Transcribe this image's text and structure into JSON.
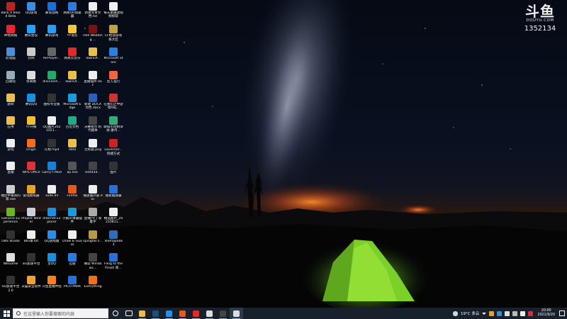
{
  "watermark": {
    "logo": "斗鱼",
    "url": "DOUYU.COM",
    "room_id": "1352134"
  },
  "desktop": {
    "icons": [
      {
        "label": "Back 4 Blood Beta",
        "color": "#b22"
      },
      {
        "label": "QQ游戏",
        "color": "#3a8de0"
      },
      {
        "label": "暴雪战网",
        "color": "#1a6fd8"
      },
      {
        "label": "网易UU加速器",
        "color": "#2d7be0"
      },
      {
        "label": "新建文本文档.txt",
        "color": "#eee"
      },
      {
        "label": "每天素播放视频抓取",
        "color": "#f0f0f0"
      },
      {
        "label": "神经网络",
        "color": "#e23"
      },
      {
        "label": "腾讯会议",
        "color": "#23a0ff"
      },
      {
        "label": "腾讯游戏",
        "color": "#2a9df4"
      },
      {
        "label": "YY语音",
        "color": "#f6c33a"
      },
      {
        "label": "Hell Wedding ...",
        "color": "#7a1010"
      },
      {
        "label": "CF枪战游戏排大区",
        "color": "#c0a040"
      },
      {
        "label": "此电脑",
        "color": "#4a8fd8"
      },
      {
        "label": "封闭",
        "color": "#ccc"
      },
      {
        "label": "AirPlayer...",
        "color": "#666"
      },
      {
        "label": "网易云音乐",
        "color": "#e02b2b"
      },
      {
        "label": "TownOf...",
        "color": "#e8c050"
      },
      {
        "label": "Microsoft Store",
        "color": "#2b80d9"
      },
      {
        "label": "回收站",
        "color": "#9ab"
      },
      {
        "label": "仿真模",
        "color": "#ddd"
      },
      {
        "label": "dilcaTech...",
        "color": "#2a6"
      },
      {
        "label": "TownOf...",
        "color": "#e8c050"
      },
      {
        "label": "直播插件.doc",
        "color": "#eee"
      },
      {
        "label": "宏入准行",
        "color": "#e64"
      },
      {
        "label": "题目",
        "color": "#e8c050"
      },
      {
        "label": "腾讯QQ",
        "color": "#1a8fe0"
      },
      {
        "label": "图标专业版",
        "color": "#333"
      },
      {
        "label": "Microsoft Edge",
        "color": "#1a9bd8"
      },
      {
        "label": "新建 DOCX 文档.docx",
        "color": "#2b5fb8"
      },
      {
        "label": "在我们之中游戏RBJ...",
        "color": "#c33"
      },
      {
        "label": "应用",
        "color": "#e8c050"
      },
      {
        "label": "YY开播",
        "color": "#f0c030"
      },
      {
        "label": "QQ图片2021021...",
        "color": "#eee"
      },
      {
        "label": "百位文档",
        "color": "#2a8"
      },
      {
        "label": "决赛组合 机代剧本",
        "color": "#444"
      },
      {
        "label": "聊城市场附净收 康月...",
        "color": "#3a7"
      },
      {
        "label": "游戏",
        "color": "#eee"
      },
      {
        "label": "Origin",
        "color": "#f56c1c"
      },
      {
        "label": "礼物.mp4",
        "color": "#333"
      },
      {
        "label": "data",
        "color": "#e8c050"
      },
      {
        "label": "无标题.png",
        "color": "#eee"
      },
      {
        "label": "Launcher... 快捷方式",
        "color": "#c22"
      },
      {
        "label": "直播",
        "color": "#eee"
      },
      {
        "label": "WPS Office",
        "color": "#d33"
      },
      {
        "label": "Garry's Mod",
        "color": "#1a7fd8"
      },
      {
        "label": "ap.exe",
        "color": "#555"
      },
      {
        "label": "444444...",
        "color": "#444"
      },
      {
        "label": "图片",
        "color": "#333"
      },
      {
        "label": "抽空中毒资的源.exe",
        "color": "#ccc"
      },
      {
        "label": "雷电模拟器",
        "color": "#f0a020"
      },
      {
        "label": "xode.dll",
        "color": "#eee"
      },
      {
        "label": "Firefox",
        "color": "#e8571e"
      },
      {
        "label": "播放器外部.doc",
        "color": "#eee"
      },
      {
        "label": "独家播放器",
        "color": "#2a6fd8"
      },
      {
        "label": "GeForce Experience",
        "color": "#6ab526"
      },
      {
        "label": "Project Winter",
        "color": "#ccd"
      },
      {
        "label": "Internet Explorer",
        "color": "#1a8fe0"
      },
      {
        "label": "小鹅声请器插件",
        "color": "#1a9bd8"
      },
      {
        "label": "直播(今了发着字",
        "color": "#aaa"
      },
      {
        "label": "精选图片_20210811...",
        "color": "#eee"
      },
      {
        "label": "OBS Studio",
        "color": "#333"
      },
      {
        "label": "BIG球.txt",
        "color": "#eee"
      },
      {
        "label": "QQ游戏版",
        "color": "#2a8fe0"
      },
      {
        "label": "Draw & Guess",
        "color": "#eee"
      },
      {
        "label": "spingfall's...",
        "color": "#b94"
      },
      {
        "label": "TeamSpeak 3",
        "color": "#2a6fb8"
      },
      {
        "label": "WeGame",
        "color": "#ddd"
      },
      {
        "label": "SG加速平台",
        "color": "#333"
      },
      {
        "label": "主QQ",
        "color": "#1a8fe0"
      },
      {
        "label": "迅雷",
        "color": "#2a7be0"
      },
      {
        "label": "微软 Windows...",
        "color": "#444"
      },
      {
        "label": "Fling to the Finish 简...",
        "color": "#2a6fd8"
      },
      {
        "label": "SG加速平台2.0",
        "color": "#333"
      },
      {
        "label": "天猫安全软件",
        "color": "#f0a030"
      },
      {
        "label": "斗鱼直播伴侣",
        "color": "#f58220"
      },
      {
        "label": "PICO PARK",
        "color": "#2a6fd8"
      },
      {
        "label": "Everything",
        "color": "#f07020"
      }
    ]
  },
  "taskbar": {
    "search_placeholder": "在这里输入你要搜索的内容",
    "apps": [
      {
        "name": "cortana",
        "color": "#1e2733"
      },
      {
        "name": "task-view",
        "color": "#1e2733"
      },
      {
        "name": "file-explorer",
        "color": "#e8c050"
      },
      {
        "name": "steam",
        "color": "#1b4f7a"
      },
      {
        "name": "app-blue",
        "color": "#2a8fe0"
      },
      {
        "name": "firefox",
        "color": "#e8571e"
      },
      {
        "name": "netease-music",
        "color": "#e02b2b"
      },
      {
        "name": "app-arrow",
        "color": "#ddd"
      },
      {
        "name": "app-dark",
        "color": "#444"
      },
      {
        "name": "obs",
        "color": "#ddd"
      }
    ],
    "tray": {
      "weather": "19°C 多云",
      "time": "20:00",
      "date": "2021/9/20"
    }
  }
}
